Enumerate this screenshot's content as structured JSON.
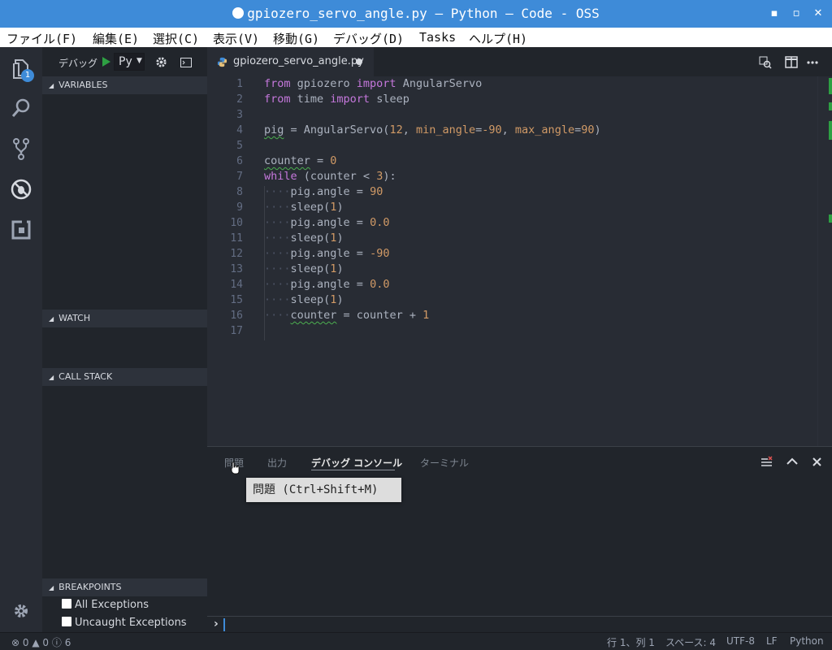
{
  "window": {
    "title": "gpiozero_servo_angle.py — Python — Code - OSS",
    "minimize_label": "▪",
    "maximize_label": "▫",
    "close_label": "✕"
  },
  "menubar": [
    "ファイル(F)",
    "編集(E)",
    "選択(C)",
    "表示(V)",
    "移動(G)",
    "デバッグ(D)",
    "Tasks",
    "ヘルプ(H)"
  ],
  "activity_bar": {
    "explorer_badge": "1",
    "icons": [
      "files-icon",
      "search-icon",
      "source-control-icon",
      "debug-icon",
      "extensions-icon",
      "settings-gear-icon"
    ]
  },
  "debug_toolbar": {
    "label": "デバッグ",
    "config": "Py",
    "play_color": "#2ea043"
  },
  "sidebar": {
    "variables": "VARIABLES",
    "watch": "WATCH",
    "call_stack": "CALL STACK",
    "breakpoints": "BREAKPOINTS",
    "breakpoint_items": [
      "All Exceptions",
      "Uncaught Exceptions"
    ]
  },
  "editor": {
    "tab_title": "gpiozero_servo_angle.py",
    "line_numbers": [
      "1",
      "2",
      "3",
      "4",
      "5",
      "6",
      "7",
      "8",
      "9",
      "10",
      "11",
      "12",
      "13",
      "14",
      "15",
      "16",
      "17"
    ]
  },
  "panel": {
    "tabs": [
      "問題",
      "出力",
      "デバッグ コンソール",
      "ターミナル"
    ],
    "active_tab": "デバッグ コンソール",
    "tooltip": "問題 (Ctrl+Shift+M)",
    "prompt": "›"
  },
  "statusbar": {
    "errors": "0",
    "warnings": "0",
    "infos": "6",
    "position": "行 1、列 1",
    "spaces": "スペース: 4",
    "encoding": "UTF-8",
    "eol": "LF",
    "language": "Python"
  },
  "colors": {
    "titlebar": "#3e8bd8",
    "accent": "#3e8bd8",
    "git_added": "#2ea043",
    "keyword": "#c678dd",
    "number": "#d19a66"
  }
}
